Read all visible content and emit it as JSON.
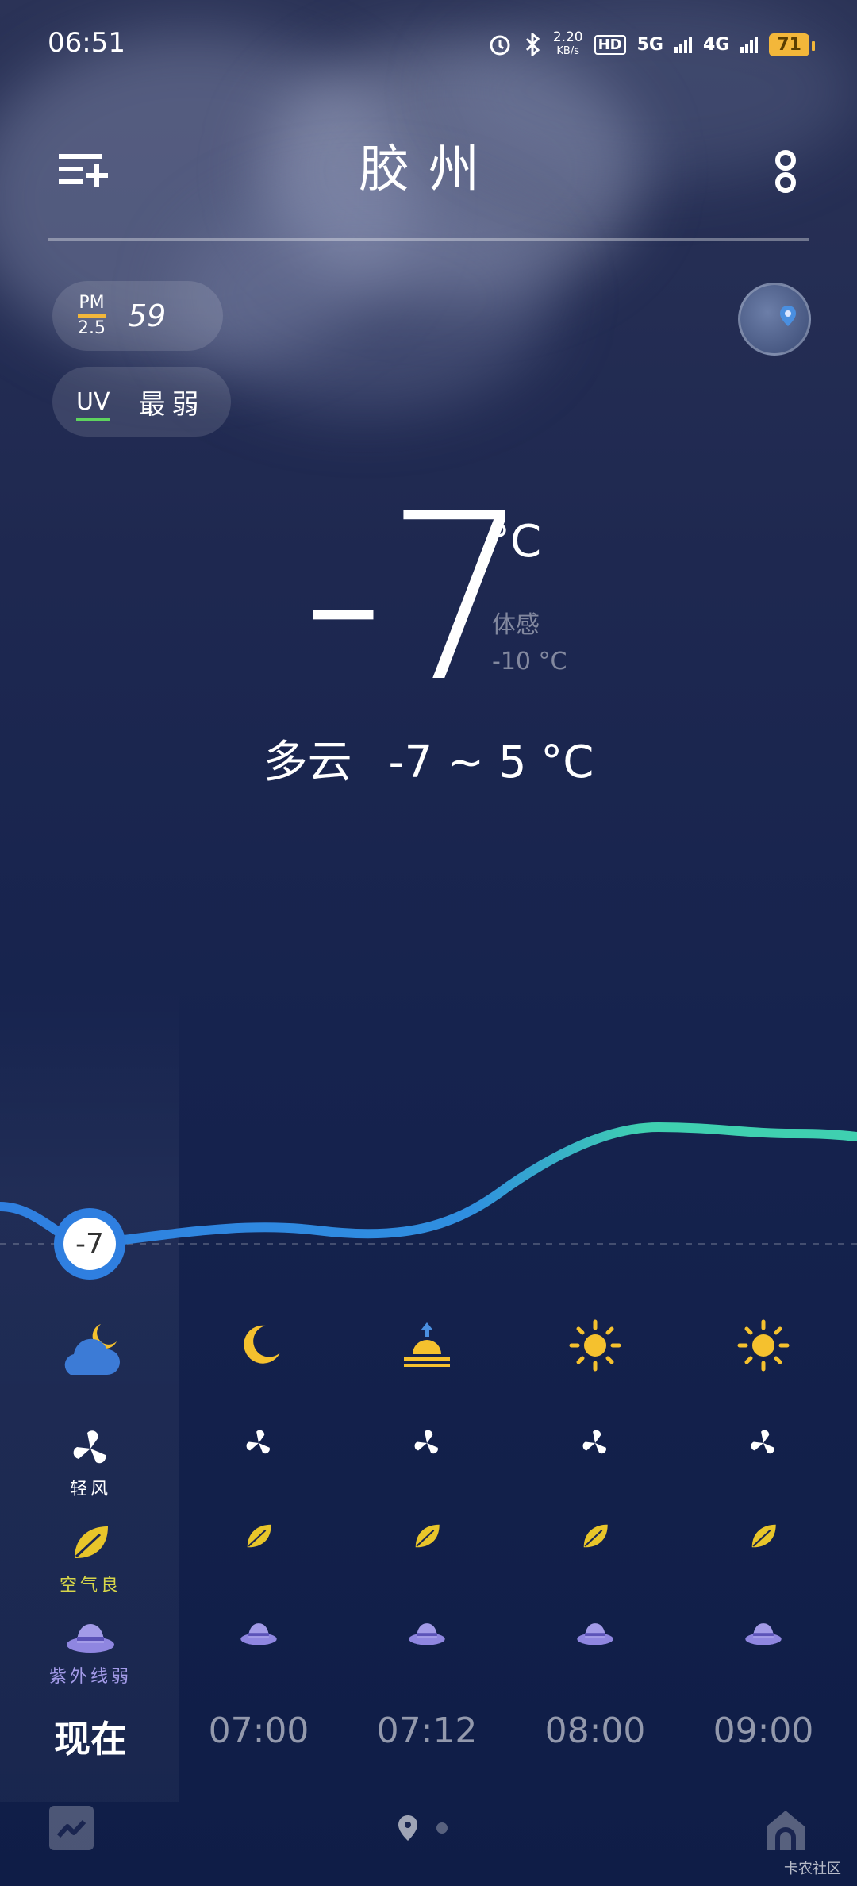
{
  "status_bar": {
    "time": "06:51",
    "net_speed_value": "2.20",
    "net_speed_unit": "KB/s",
    "hd_label": "HD",
    "net_5g": "5G",
    "net_4g": "4G",
    "battery": "71"
  },
  "header": {
    "city": "胶州"
  },
  "air": {
    "pm_label_top": "PM",
    "pm_label_bottom": "2.5",
    "pm_value": "59",
    "uv_label": "UV",
    "uv_value": "最弱"
  },
  "current": {
    "temperature": "-7",
    "unit": "°C",
    "feels_label": "体感",
    "feels_value": "-10 °C",
    "condition": "多云",
    "range": "-7 ~ 5 °C"
  },
  "hourly": {
    "now_temp": "-7",
    "columns": [
      {
        "time": "现在",
        "icon": "cloudy-night-icon",
        "wind_label": "轻风",
        "air_label": "空气良",
        "uv_label": "紫外线弱"
      },
      {
        "time": "07:00",
        "icon": "moon-icon"
      },
      {
        "time": "07:12",
        "icon": "sunrise-icon"
      },
      {
        "time": "08:00",
        "icon": "sun-icon"
      },
      {
        "time": "09:00",
        "icon": "sun-icon"
      }
    ]
  },
  "colors": {
    "accent_blue": "#2f7fe0",
    "curve_teal": "#3fd0b0",
    "sun_yellow": "#f5c12e",
    "leaf_yellow": "#e8c52a",
    "hat_purple": "#8f86e0",
    "air_label": "#d7d64a",
    "uv_label": "#a39be8"
  },
  "watermark": "卡农社区"
}
